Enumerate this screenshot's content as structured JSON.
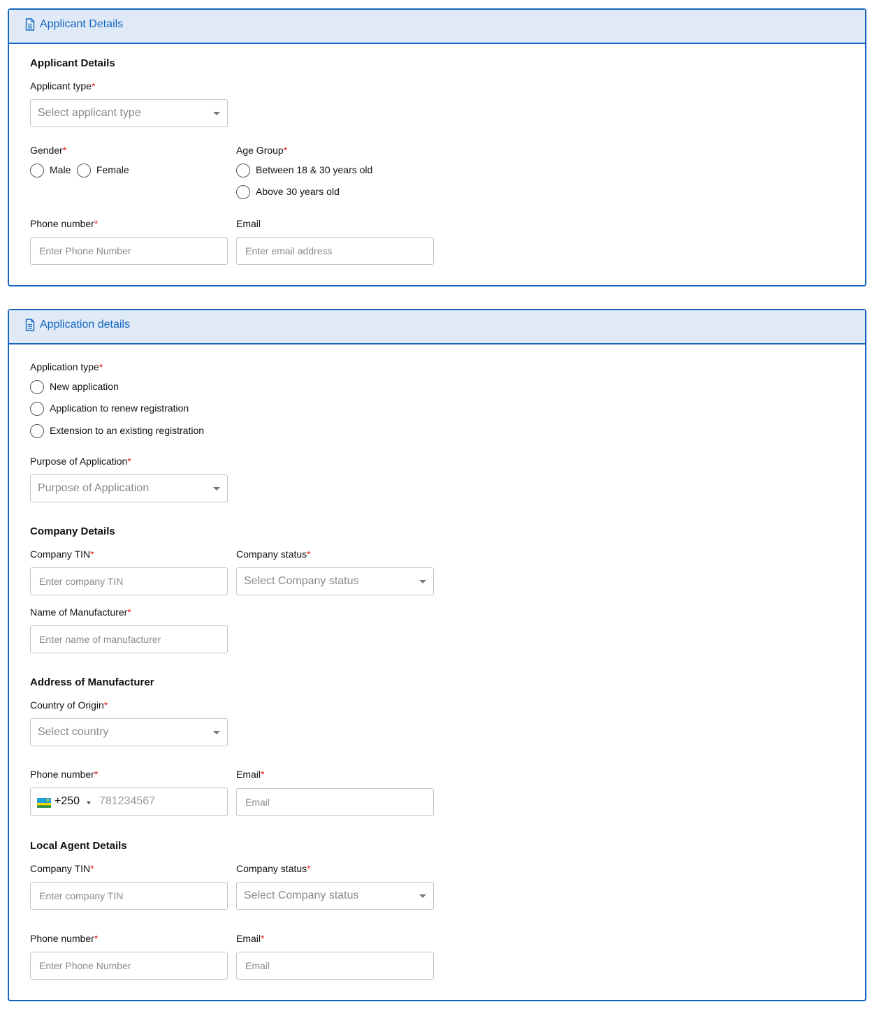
{
  "panel1": {
    "header_title": "Applicant Details",
    "section_title": "Applicant Details",
    "applicant_type": {
      "label": "Applicant type",
      "required": "*",
      "placeholder": "Select applicant type"
    },
    "gender": {
      "label": "Gender",
      "required": "*",
      "options": [
        "Male",
        "Female"
      ]
    },
    "age_group": {
      "label": "Age Group",
      "required": "*",
      "options": [
        "Between 18 & 30 years old",
        "Above 30 years old"
      ]
    },
    "phone": {
      "label": "Phone number",
      "required": "*",
      "placeholder": "Enter Phone Number"
    },
    "email": {
      "label": "Email",
      "placeholder": "Enter email address"
    }
  },
  "panel2": {
    "header_title": "Application details",
    "application_type": {
      "label": "Application type",
      "required": "*",
      "options": [
        "New application",
        "Application to renew registration",
        "Extension to an existing registration"
      ]
    },
    "purpose": {
      "label": "Purpose of Application",
      "required": "*",
      "placeholder": "Purpose of Application"
    },
    "company": {
      "title": "Company Details",
      "tin": {
        "label": "Company TIN",
        "required": "*",
        "placeholder": "Enter company TIN"
      },
      "status": {
        "label": "Company status",
        "required": "*",
        "placeholder": "Select Company status"
      },
      "manufacturer": {
        "label": "Name of Manufacturer",
        "required": "*",
        "placeholder": "Enter name of manufacturer"
      }
    },
    "address": {
      "title": "Address of Manufacturer",
      "country": {
        "label": "Country of Origin",
        "required": "*",
        "placeholder": "Select country"
      },
      "phone": {
        "label": "Phone number",
        "required": "*",
        "dial_code": "+250",
        "placeholder": "781234567",
        "flag": "rwanda-flag-icon"
      },
      "email": {
        "label": "Email",
        "required": "*",
        "placeholder": "Email"
      }
    },
    "agent": {
      "title": "Local Agent Details",
      "tin": {
        "label": "Company TIN",
        "required": "*",
        "placeholder": "Enter company TIN"
      },
      "status": {
        "label": "Company status",
        "required": "*",
        "placeholder": "Select Company status"
      },
      "phone": {
        "label": "Phone number",
        "required": "*",
        "placeholder": "Enter Phone Number"
      },
      "email": {
        "label": "Email",
        "required": "*",
        "placeholder": "Email"
      }
    }
  },
  "colors": {
    "accent": "#1565c0",
    "header_bg": "#dfeaf6",
    "required": "#e02020",
    "border": "#c4c4c4"
  }
}
